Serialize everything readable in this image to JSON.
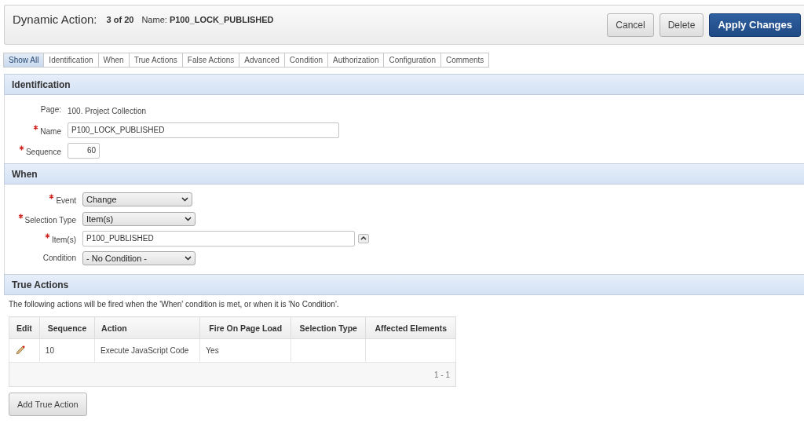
{
  "header": {
    "title": "Dynamic Action:",
    "position": "3 of 20",
    "name_label": "Name:",
    "name": "P100_LOCK_PUBLISHED"
  },
  "buttons": [
    {
      "label": "Cancel",
      "kind": "plain"
    },
    {
      "label": "Delete",
      "kind": "plain"
    },
    {
      "label": "Apply Changes",
      "kind": "primary"
    }
  ],
  "tabs": [
    {
      "label": "Show All",
      "selected": true
    },
    {
      "label": "Identification",
      "selected": false
    },
    {
      "label": "When",
      "selected": false
    },
    {
      "label": "True Actions",
      "selected": false
    },
    {
      "label": "False Actions",
      "selected": false
    },
    {
      "label": "Advanced",
      "selected": false
    },
    {
      "label": "Condition",
      "selected": false
    },
    {
      "label": "Authorization",
      "selected": false
    },
    {
      "label": "Configuration",
      "selected": false
    },
    {
      "label": "Comments",
      "selected": false
    }
  ],
  "identification": {
    "title": "Identification",
    "fields": [
      {
        "label": "Page:",
        "kind": "display",
        "required": false,
        "value": "100. Project Collection"
      },
      {
        "label": "Name",
        "kind": "text",
        "required": true,
        "value": "P100_LOCK_PUBLISHED"
      },
      {
        "label": "Sequence",
        "kind": "number",
        "required": true,
        "value": "60"
      }
    ]
  },
  "when": {
    "title": "When",
    "fields": [
      {
        "label": "Event",
        "kind": "select",
        "required": true,
        "value": "Change"
      },
      {
        "label": "Selection Type",
        "kind": "select",
        "required": true,
        "value": "Item(s)"
      },
      {
        "label": "Item(s)",
        "kind": "picker",
        "required": true,
        "value": "P100_PUBLISHED"
      },
      {
        "label": "Condition",
        "kind": "select",
        "required": false,
        "value": "- No Condition -"
      }
    ]
  },
  "true_actions": {
    "title": "True Actions",
    "description": "The following actions will be fired when the 'When' condition is met, or when it is 'No Condition'.",
    "table": {
      "columns": [
        "Edit",
        "Sequence",
        "Action",
        "Fire On Page Load",
        "Selection Type",
        "Affected Elements"
      ],
      "rows": [
        {
          "sequence": "10",
          "action": "Execute JavaScript Code",
          "fire_on_page_load": "Yes",
          "selection_type": "",
          "affected_elements": ""
        }
      ],
      "pagination": "1 - 1"
    },
    "add_button": "Add True Action"
  }
}
